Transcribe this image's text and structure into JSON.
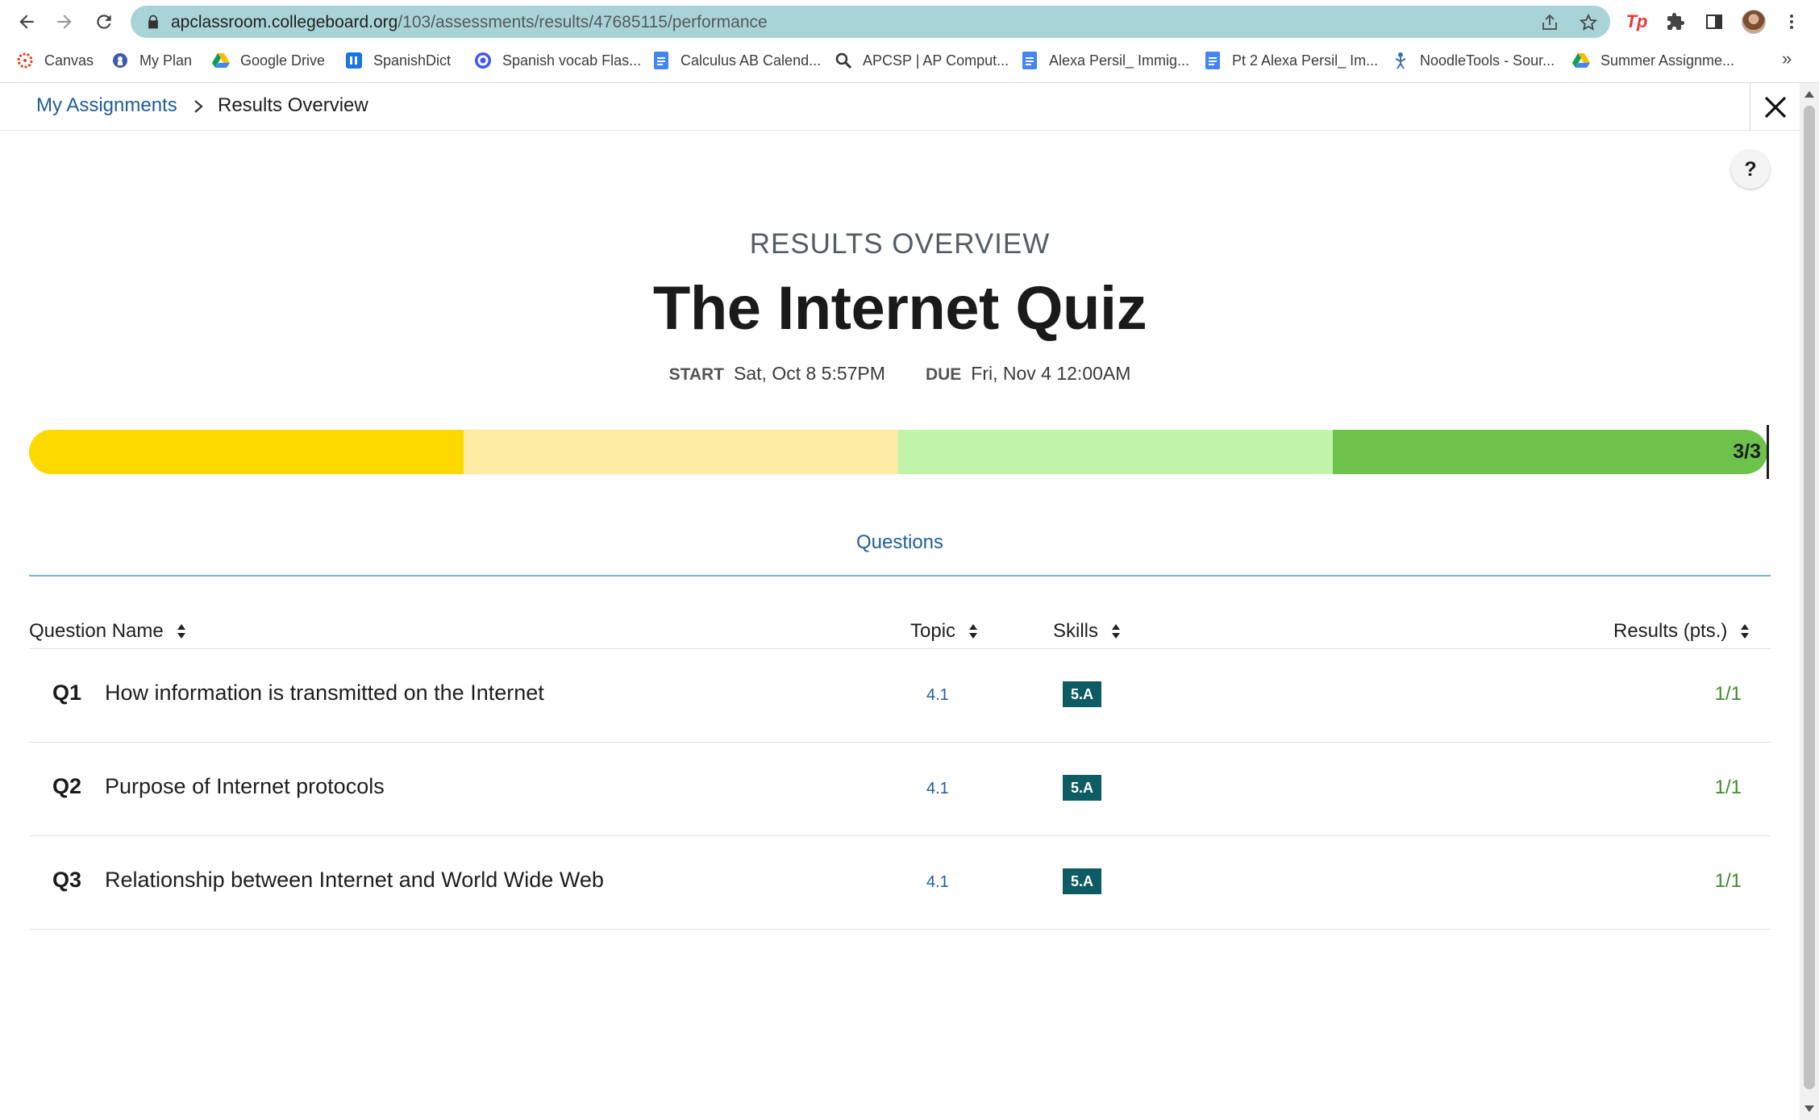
{
  "browser": {
    "url_host": "apclassroom.collegeboard.org",
    "url_path": "/103/assessments/results/47685115/performance",
    "bookmarks": [
      {
        "label": "Canvas",
        "icon": "canvas-icon"
      },
      {
        "label": "My Plan",
        "icon": "myplan-icon"
      },
      {
        "label": "Google Drive",
        "icon": "google-drive-icon"
      },
      {
        "label": "SpanishDict",
        "icon": "spanishdict-icon"
      },
      {
        "label": "Spanish vocab Flas...",
        "icon": "quizlet-icon"
      },
      {
        "label": "Calculus AB Calend...",
        "icon": "docs-icon"
      },
      {
        "label": "APCSP | AP Comput...",
        "icon": "apcsp-icon"
      },
      {
        "label": "Alexa Persil_ Immig...",
        "icon": "docs-icon"
      },
      {
        "label": "Pt 2 Alexa Persil_ Im...",
        "icon": "docs-icon"
      },
      {
        "label": "NoodleTools - Sour...",
        "icon": "noodletools-icon"
      },
      {
        "label": "Summer Assignme...",
        "icon": "google-drive-icon"
      }
    ],
    "more_bookmarks": "»"
  },
  "breadcrumb": {
    "parent": "My Assignments",
    "current": "Results Overview"
  },
  "help_label": "?",
  "header": {
    "eyebrow": "RESULTS OVERVIEW",
    "title": "The Internet Quiz",
    "start_label": "START",
    "start_value": "Sat, Oct 8 5:57PM",
    "due_label": "DUE",
    "due_value": "Fri, Nov 4 12:00AM"
  },
  "progress": {
    "label": "3/3",
    "score": 3,
    "total": 3,
    "colors": [
      "#fdd900",
      "#feeba3",
      "#c0f4a9",
      "#6cc24a"
    ]
  },
  "tabs": [
    {
      "label": "Questions",
      "active": true
    }
  ],
  "table": {
    "columns": {
      "name": "Question Name",
      "topic": "Topic",
      "skills": "Skills",
      "results": "Results (pts.)"
    },
    "rows": [
      {
        "num": "Q1",
        "name": "How information is transmitted on the Internet",
        "topic": "4.1",
        "skill": "5.A",
        "score": "1/1"
      },
      {
        "num": "Q2",
        "name": "Purpose of Internet protocols",
        "topic": "4.1",
        "skill": "5.A",
        "score": "1/1"
      },
      {
        "num": "Q3",
        "name": "Relationship between Internet and World Wide Web",
        "topic": "4.1",
        "skill": "5.A",
        "score": "1/1"
      }
    ]
  },
  "colors": {
    "link": "#1f5e99",
    "skill_badge": "#0e5c63",
    "score_green": "#3f8a2b",
    "omnibox": "#a9d4d7"
  }
}
